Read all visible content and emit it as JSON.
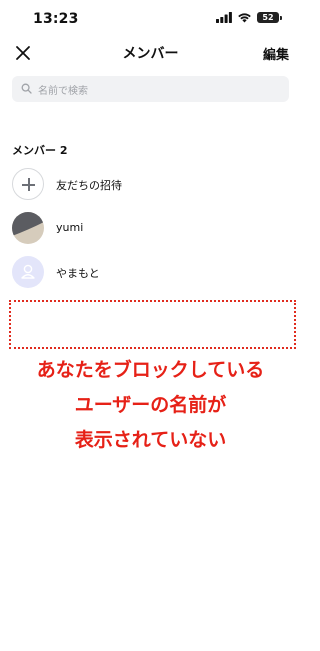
{
  "status_bar": {
    "time": "13:23",
    "battery": "52"
  },
  "nav": {
    "title": "メンバー",
    "edit_label": "編集"
  },
  "search": {
    "placeholder": "名前で検索"
  },
  "section": {
    "header": "メンバー 2"
  },
  "members": [
    {
      "label": "友だちの招待"
    },
    {
      "label": "yumi"
    },
    {
      "label": "やまもと"
    }
  ],
  "annotation": {
    "lines": [
      "あなたをブロックしている",
      "ユーザーの名前が",
      "表示されていない"
    ],
    "color": "#e62117"
  },
  "icons": {
    "close": "close-icon",
    "search": "search-icon",
    "invite": "plus-icon",
    "default_avatar": "person-icon"
  }
}
